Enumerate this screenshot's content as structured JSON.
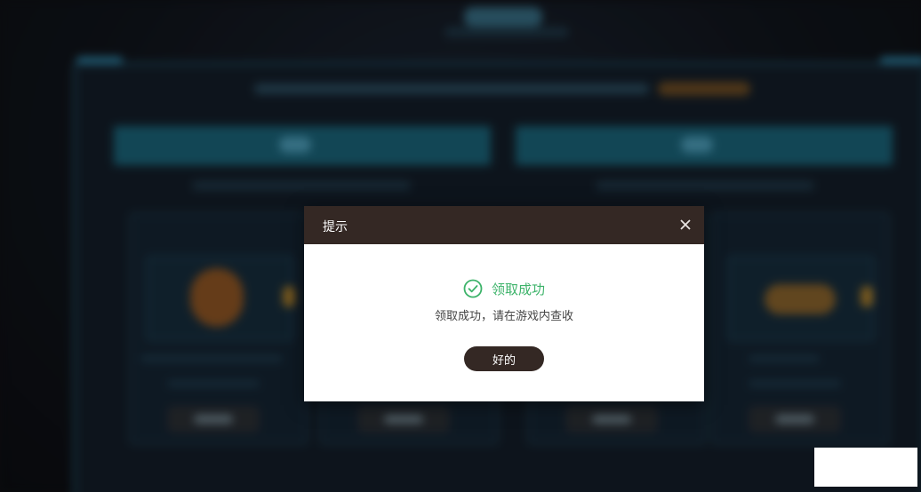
{
  "dialog": {
    "title": "提示",
    "status_text": "领取成功",
    "message": "领取成功，请在游戏内查收",
    "ok_label": "好的",
    "header_color": "#342824",
    "success_color": "#3db36a"
  },
  "icons": {
    "close": "close-icon",
    "success": "check-circle-icon"
  }
}
